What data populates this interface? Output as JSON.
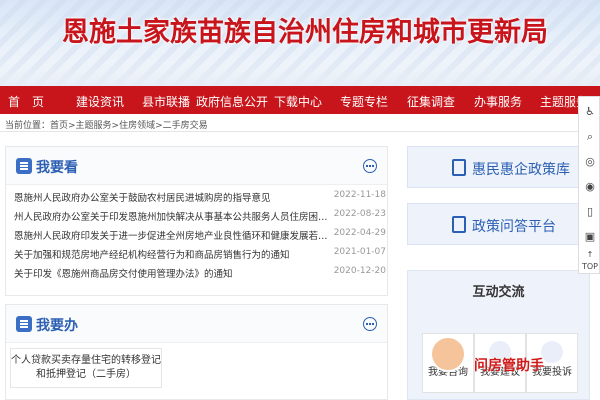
{
  "header": {
    "site_title": "恩施土家族苗族自治州住房和城市更新局"
  },
  "nav": {
    "items": [
      "首　页",
      "建设资讯",
      "县市联播",
      "政府信息公开",
      "下载中心",
      "专题专栏",
      "征集调查",
      "办事服务",
      "主题服务"
    ]
  },
  "breadcrumb": {
    "prefix": "当前位置：",
    "path": "首页>主题服务>住房领域>二手房交易"
  },
  "want_to_see": {
    "title": "我要看",
    "items": [
      {
        "title": "恩施州人民政府办公室关于鼓励农村居民进城购房的指导意见",
        "date": "2022-11-18"
      },
      {
        "title": "州人民政府办公室关于印发恩施州加快解决从事基本公共服务人员住房困难问题实施方案的通知",
        "date": "2022-08-23"
      },
      {
        "title": "恩施州人民政府印发关于进一步促进全州房地产业良性循环和健康发展若干措施的通知",
        "date": "2022-04-29"
      },
      {
        "title": "关于加强和规范房地产经纪机构经营行为和商品房销售行为的通知",
        "date": "2021-01-07"
      },
      {
        "title": "关于印发《恩施州商品房交付使用管理办法》的通知",
        "date": "2020-12-20"
      }
    ]
  },
  "want_to_do": {
    "title": "我要办",
    "service_card": "个人贷款买卖存量住宅的转移登记和抵押登记（二手房）"
  },
  "right": {
    "policy_lib": "惠民惠企政策库",
    "policy_qa": "政策问答平台",
    "interaction": {
      "title": "互动交流",
      "items": [
        "我要咨询",
        "我要建议",
        "我要投诉"
      ]
    },
    "assistant_label": "问房管助手"
  },
  "float_bar": {
    "icons": [
      "accessibility-icon",
      "search-icon",
      "wechat-icon",
      "weibo-icon",
      "mobile-icon",
      "app-icon",
      "top-icon"
    ],
    "top_label": "TOP"
  },
  "colors": {
    "brand_red": "#c8141b",
    "accent_blue": "#2b5fb3"
  }
}
